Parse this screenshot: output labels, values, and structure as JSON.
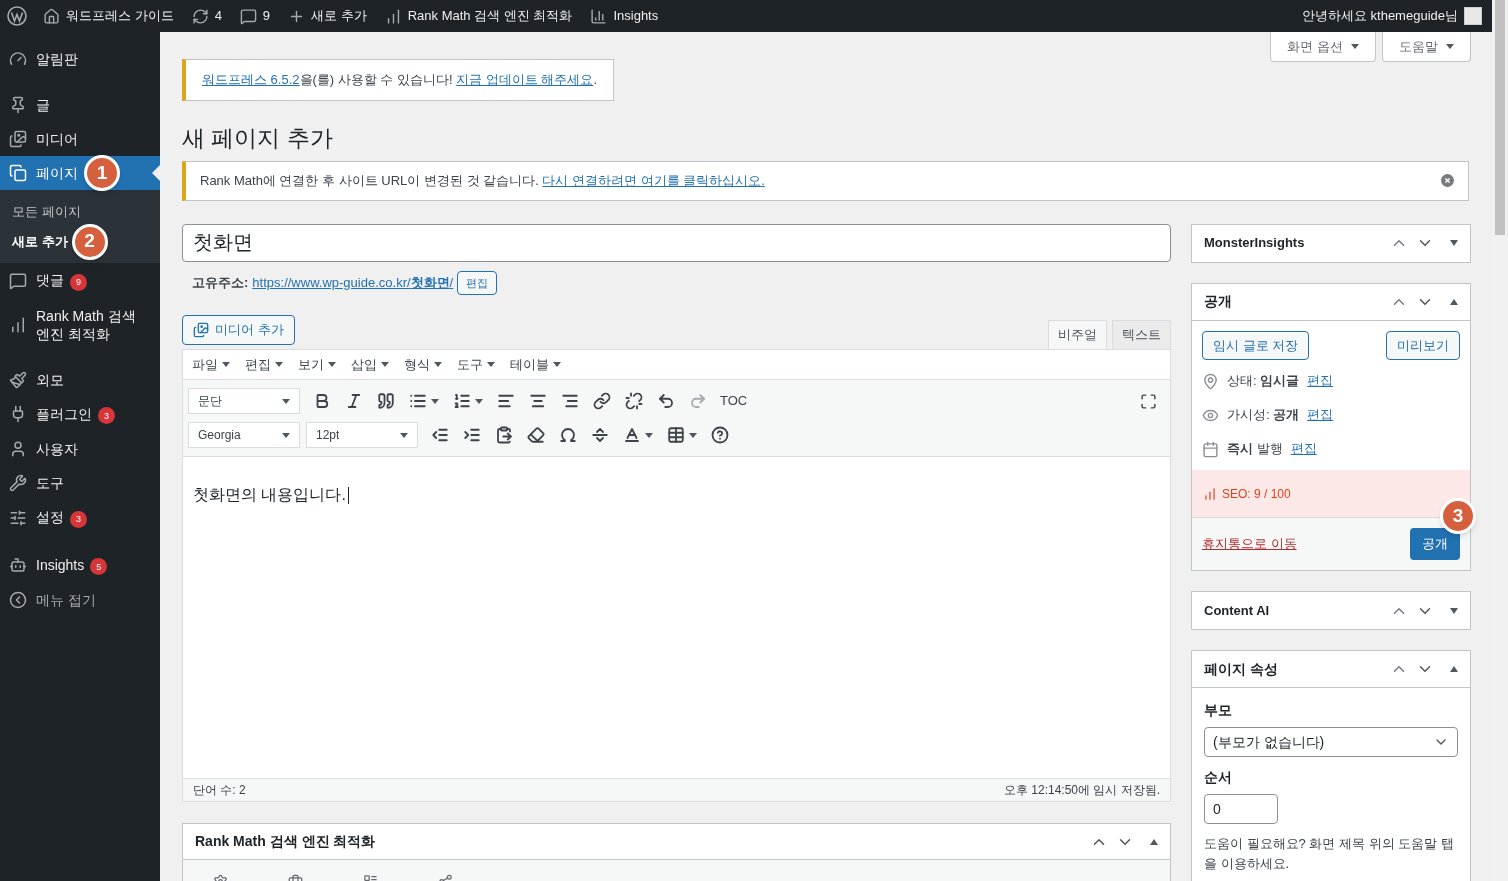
{
  "admin_bar": {
    "items": [
      {
        "kind": "wp"
      },
      {
        "kind": "home",
        "label": "워드프레스 가이드"
      },
      {
        "kind": "updates",
        "label": "4"
      },
      {
        "kind": "comments",
        "label": "9"
      },
      {
        "kind": "new",
        "label": "새로 추가"
      },
      {
        "kind": "rankmath",
        "label": "Rank Math 검색 엔진 최적화"
      },
      {
        "kind": "insights",
        "label": "Insights"
      }
    ],
    "greeting": "안녕하세요 kthemeguide님"
  },
  "menu": {
    "groups": [
      {
        "items": [
          {
            "kind": "dashboard",
            "label": "알림판",
            "selected": false
          }
        ]
      },
      {
        "items": [
          {
            "kind": "posts",
            "label": "글",
            "selected": false
          },
          {
            "kind": "media",
            "label": "미디어",
            "selected": false
          },
          {
            "kind": "pages",
            "label": "페이지",
            "selected": true,
            "callout": "1",
            "children": [
              {
                "label": "모든 페이지",
                "selected": false
              },
              {
                "label": "새로 추가",
                "selected": true,
                "callout": "2"
              }
            ]
          },
          {
            "kind": "comments",
            "label": "댓글",
            "selected": false,
            "badge": "9"
          },
          {
            "kind": "rankmath",
            "label": "Rank Math 검색 엔진 최적화",
            "selected": false
          }
        ]
      },
      {
        "items": [
          {
            "kind": "appearance",
            "label": "외모",
            "selected": false
          },
          {
            "kind": "plugins",
            "label": "플러그인",
            "selected": false,
            "badge": "3"
          },
          {
            "kind": "users",
            "label": "사용자",
            "selected": false
          },
          {
            "kind": "tools",
            "label": "도구",
            "selected": false
          },
          {
            "kind": "settings",
            "label": "설정",
            "selected": false,
            "badge": "3"
          }
        ]
      },
      {
        "items": [
          {
            "kind": "insights",
            "label": "Insights",
            "selected": false,
            "badge": "5"
          },
          {
            "kind": "collapse",
            "label": "메뉴 접기",
            "selected": false
          }
        ]
      }
    ]
  },
  "screen_buttons": [
    "화면 옵션",
    "도움말"
  ],
  "update_notice": [
    {
      "text": "워드프레스 6.5.2",
      "link": true
    },
    {
      "text": "을(를) 사용할 수 있습니다! ",
      "link": false
    },
    {
      "text": "지금 업데이트 해주세요",
      "link": true
    },
    {
      "text": ".",
      "link": false
    }
  ],
  "page_title": "새 페이지 추가",
  "rank_notice": [
    {
      "text": "Rank Math에 연결한 후 사이트 URL이 변경된 것 같습니다. ",
      "link": false
    },
    {
      "text": "다시 연결하려면 여기를 클릭하십시오.",
      "link": true
    }
  ],
  "title_field": {
    "value": "첫화면"
  },
  "permalink": {
    "label": "고유주소:",
    "url": "https://www.wp-guide.co.kr/**첫화면**/",
    "edit": "편집"
  },
  "media_button": "미디어 추가",
  "editor_tabs": [
    {
      "label": "비주얼",
      "selected": true
    },
    {
      "label": "텍스트",
      "selected": false
    }
  ],
  "editor_menus": [
    "파일",
    "편집",
    "보기",
    "삽입",
    "형식",
    "도구",
    "테이블"
  ],
  "toolbar_rows": [
    {
      "selects": [
        {
          "value": "문단"
        }
      ],
      "tools": [
        {
          "kind": "bold",
          "caret": false,
          "disabled": false
        },
        {
          "kind": "italic",
          "caret": false,
          "disabled": false
        },
        {
          "kind": "quote",
          "caret": false,
          "disabled": false
        },
        {
          "kind": "bullets",
          "caret": true,
          "disabled": false
        },
        {
          "kind": "numbers",
          "caret": true,
          "disabled": false
        },
        {
          "kind": "align-left",
          "caret": false,
          "disabled": false
        },
        {
          "kind": "align-center",
          "caret": false,
          "disabled": false
        },
        {
          "kind": "align-right",
          "caret": false,
          "disabled": false
        },
        {
          "kind": "link",
          "caret": false,
          "disabled": false
        },
        {
          "kind": "unlink",
          "caret": false,
          "disabled": false
        },
        {
          "kind": "undo",
          "caret": false,
          "disabled": false
        },
        {
          "kind": "redo",
          "caret": false,
          "disabled": true
        },
        {
          "kind": "text",
          "label": "TOC",
          "caret": false,
          "disabled": false
        }
      ],
      "end_tool": {
        "kind": "fullscreen"
      }
    },
    {
      "selects": [
        {
          "value": "Georgia"
        },
        {
          "value": "12pt"
        }
      ],
      "tools": [
        {
          "kind": "outdent",
          "caret": false,
          "disabled": false
        },
        {
          "kind": "indent",
          "caret": false,
          "disabled": false
        },
        {
          "kind": "paste",
          "caret": false,
          "disabled": false
        },
        {
          "kind": "eraser",
          "caret": false,
          "disabled": false
        },
        {
          "kind": "omega",
          "caret": false,
          "disabled": false
        },
        {
          "kind": "hr",
          "caret": false,
          "disabled": false
        },
        {
          "kind": "color",
          "caret": true,
          "disabled": false
        },
        {
          "kind": "table",
          "caret": true,
          "disabled": false
        },
        {
          "kind": "help",
          "caret": false,
          "disabled": false
        }
      ]
    }
  ],
  "editor_content": "첫화면의 내용입니다.",
  "status_bar": {
    "word_count": "단어 수: 2",
    "saved": "오후 12:14:50에 임시 저장됨."
  },
  "rank_math_box": {
    "title": "Rank Math 검색 엔진 최적화",
    "tabs": [
      {
        "kind": "general"
      },
      {
        "kind": "advanced"
      },
      {
        "kind": "schema"
      },
      {
        "kind": "social"
      }
    ]
  },
  "side_boxes": [
    {
      "kind": "plain",
      "title": "MonsterInsights",
      "expanded": false
    },
    {
      "kind": "publish",
      "title": "공개",
      "expanded": true,
      "save_draft": "임시 글로 저장",
      "preview": "미리보기",
      "rows": [
        {
          "kind": "status",
          "text": "상태: **임시글**",
          "link": "편집"
        },
        {
          "kind": "visibility",
          "text": "가시성: **공개**",
          "link": "편집"
        },
        {
          "kind": "schedule",
          "text": "**즉시** 발행",
          "link": "편집"
        }
      ],
      "seo": "SEO: 9 / 100",
      "trash": "휴지통으로 이동",
      "publish": "공개",
      "callout": "3"
    },
    {
      "kind": "plain",
      "title": "Content AI",
      "expanded": false
    },
    {
      "kind": "attributes",
      "title": "페이지 속성",
      "expanded": true,
      "parent_label": "부모",
      "parent_value": "(부모가 없습니다)",
      "order_label": "순서",
      "order_value": "0",
      "help": "도움이 필요해요? 화면 제목 위의 도움말 탭을 이용하세요."
    }
  ]
}
